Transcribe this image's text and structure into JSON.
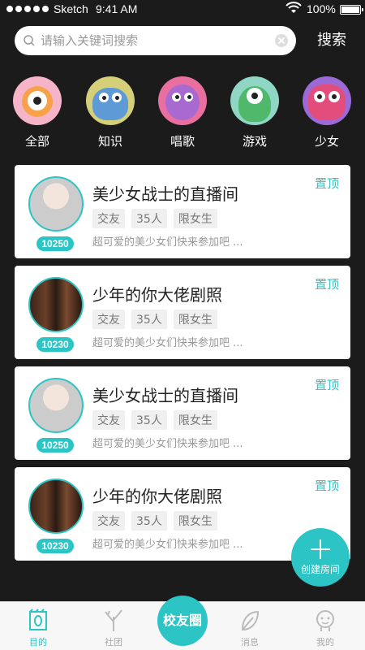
{
  "status_bar": {
    "carrier": "Sketch",
    "time": "9:41 AM",
    "battery": "100%"
  },
  "search": {
    "placeholder": "请输入关键词搜索",
    "button_label": "搜索"
  },
  "categories": [
    {
      "label": "全部",
      "icon": "orange-monster",
      "color": "#f7a24b"
    },
    {
      "label": "知识",
      "icon": "blue-monster",
      "color": "#5e9ad6"
    },
    {
      "label": "唱歌",
      "icon": "purple-monster",
      "color": "#a86ad0"
    },
    {
      "label": "游戏",
      "icon": "green-monster",
      "color": "#4fb86a"
    },
    {
      "label": "少女",
      "icon": "pink-monster",
      "color": "#e24d7c"
    }
  ],
  "rooms": [
    {
      "title": "美少女战士的直播间",
      "count": "10250",
      "tags": [
        "交友",
        "35人",
        "限女生"
      ],
      "desc": "超可爱的美少女们快来参加吧 ...",
      "pin": "置顶"
    },
    {
      "title": "少年的你大佬剧照",
      "count": "10230",
      "tags": [
        "交友",
        "35人",
        "限女生"
      ],
      "desc": "超可爱的美少女们快来参加吧 ...",
      "pin": "置顶"
    },
    {
      "title": "美少女战士的直播间",
      "count": "10250",
      "tags": [
        "交友",
        "35人",
        "限女生"
      ],
      "desc": "超可爱的美少女们快来参加吧 ...",
      "pin": "置顶"
    },
    {
      "title": "少年的你大佬剧照",
      "count": "10230",
      "tags": [
        "交友",
        "35人",
        "限女生"
      ],
      "desc": "超可爱的美少女们快来参加吧 ...",
      "pin": "置顶"
    }
  ],
  "fab": {
    "label": "创建房间"
  },
  "tabs": [
    {
      "label": "目的",
      "active": true
    },
    {
      "label": "社团"
    },
    {
      "label": "消息"
    },
    {
      "label": "我的"
    }
  ],
  "center_tab": {
    "label": "校友圈"
  },
  "colors": {
    "accent": "#2cc4c4",
    "background": "#1b1b1b"
  }
}
